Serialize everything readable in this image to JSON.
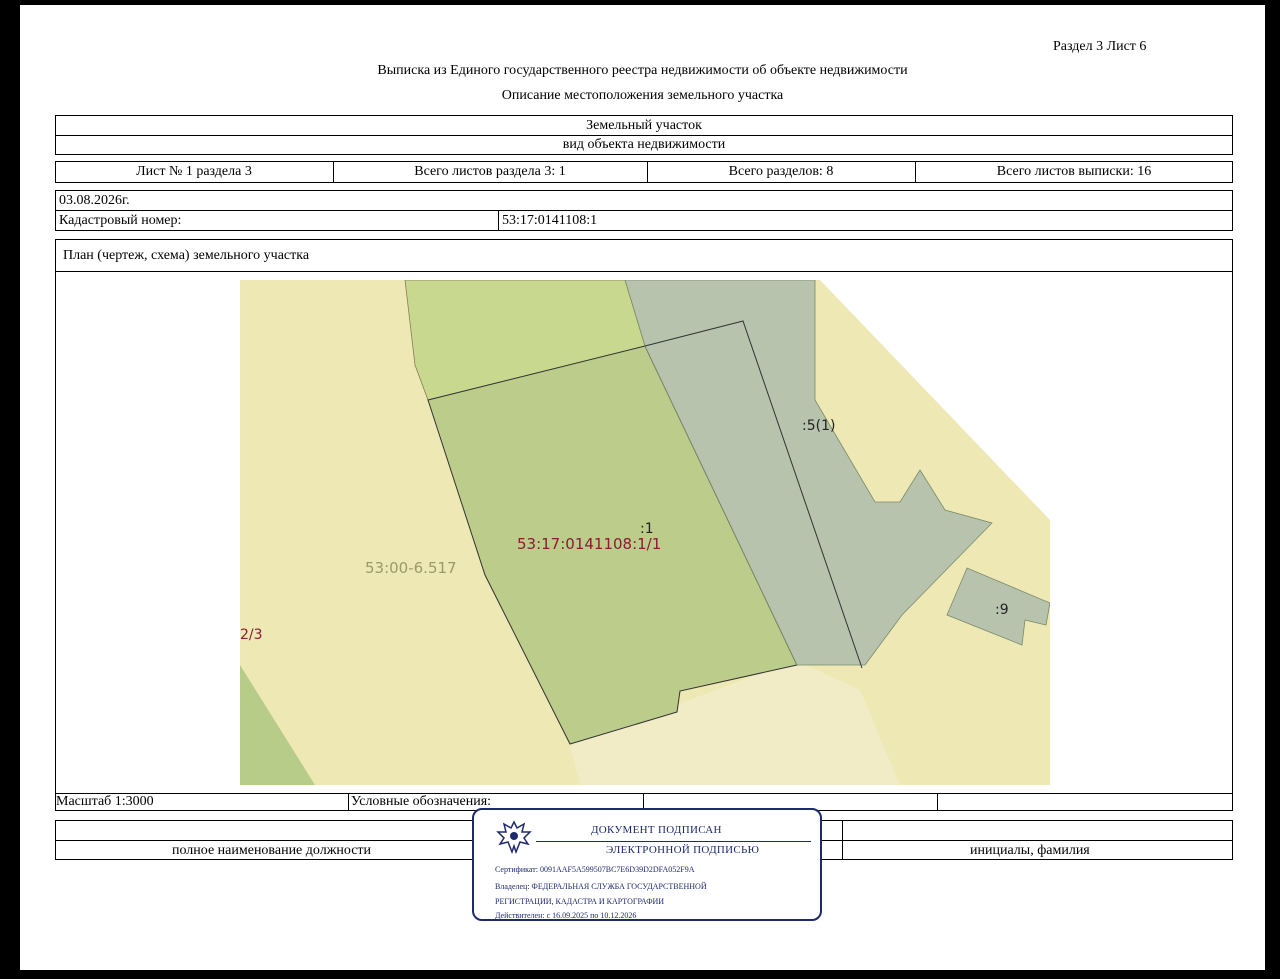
{
  "header": {
    "section_sheet": "Раздел 3   Лист 6",
    "title": "Выписка из Единого государственного реестра недвижимости об объекте недвижимости",
    "subtitle": "Описание местоположения земельного участка"
  },
  "object": {
    "name": "Земельный участок",
    "type_label": "вид объекта недвижимости"
  },
  "sheet_row": {
    "sheet_no": "Лист № 1 раздела 3",
    "total_sheets_section": "Всего листов раздела 3: 1",
    "total_sections": "Всего разделов: 8",
    "total_sheets_extract": "Всего листов выписки: 16"
  },
  "info": {
    "date": "03.08.2026г.",
    "cadastral_label": "Кадастровый номер:",
    "cadastral_number": "53:17:0141108:1"
  },
  "plan": {
    "label": "План (чертеж, схема) земельного участка",
    "scale": "Масштаб 1:3000",
    "legend_label": "Условные обозначения:"
  },
  "map_labels": {
    "zone": "53:00-6.517",
    "parcel_part": "53:17:0141108:1/1",
    "parcel": ":1",
    "neighbor_5": ":5(1)",
    "neighbor_9": ":9",
    "left_edge": "2/3"
  },
  "colors": {
    "beige": "#ede8b4",
    "beige_light": "#f1ecc6",
    "green_light": "#c8d98f",
    "green_main": "#bccc8a",
    "grey_green": "#b7c3ad",
    "label_red": "#8c1a3a",
    "stamp_blue": "#1e2a6b"
  },
  "footer": {
    "position_label": "полное наименование должности",
    "initials_label": "инициалы, фамилия"
  },
  "stamp": {
    "line1": "ДОКУМЕНТ ПОДПИСАН",
    "line2": "ЭЛЕКТРОННОЙ ПОДПИСЬЮ",
    "certificate": "Сертификат: 0091AAF5A599507BC7E6D39D2DFA052F9A",
    "owner1": "Владелец: ФЕДЕРАЛЬНАЯ СЛУЖБА ГОСУДАРСТВЕННОЙ",
    "owner2": "РЕГИСТРАЦИИ, КАДАСТРА И КАРТОГРАФИИ",
    "validity": "Действителен: с 16.09.2025 по 10.12.2026"
  }
}
